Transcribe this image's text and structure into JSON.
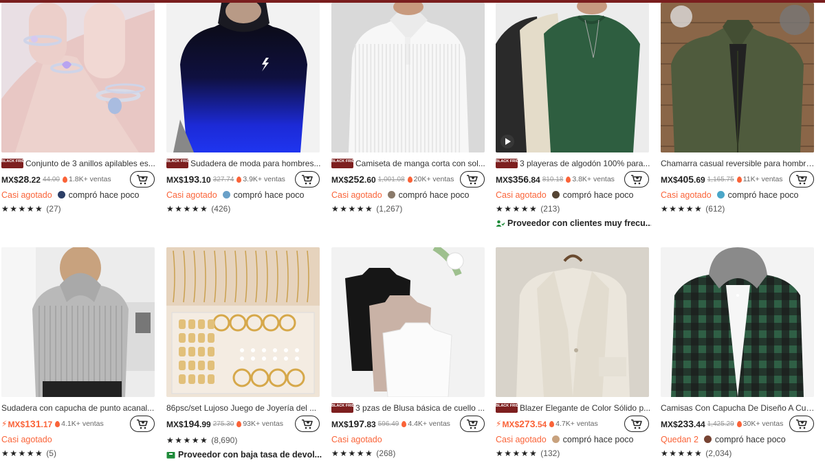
{
  "colors": {
    "accent": "#fa6338",
    "black_friday": "#7d1f1f",
    "supplier_badge": "#1f8b3a"
  },
  "products": [
    {
      "title": "Conjunto de 3 anillos apilables es...",
      "black_friday": true,
      "black_friday_label": "BLACK FRIDAY",
      "currency": "MX$",
      "price_int": "28",
      "price_dec": ".22",
      "old_price": "44.00",
      "sales": "1.8K+ ventas",
      "flash": false,
      "stock": "Casi agotado",
      "buyer": "compró hace poco",
      "stars": "★★★★★",
      "reviews": "(27)",
      "badge": "",
      "image_icon": "rings-photo",
      "video": false
    },
    {
      "title": "Sudadera de moda para hombres...",
      "black_friday": true,
      "black_friday_label": "BLACK FRIDAY",
      "currency": "MX$",
      "price_int": "193",
      "price_dec": ".10",
      "old_price": "327.74",
      "sales": "3.9K+ ventas",
      "flash": false,
      "stock": "Casi agotado",
      "buyer": "compró hace poco",
      "stars": "★★★★★",
      "reviews": "(426)",
      "badge": "",
      "image_icon": "hoodie-photo",
      "video": false
    },
    {
      "title": "Camiseta de manga corta con sol...",
      "black_friday": true,
      "black_friday_label": "BLACK FRIDAY",
      "currency": "MX$",
      "price_int": "252",
      "price_dec": ".60",
      "old_price": "1,001.08",
      "sales": "20K+ ventas",
      "flash": false,
      "stock": "Casi agotado",
      "buyer": "compró hace poco",
      "stars": "★★★★★",
      "reviews": "(1,267)",
      "badge": "",
      "image_icon": "white-polo-photo",
      "video": false
    },
    {
      "title": "3 playeras de algodón 100% para...",
      "black_friday": true,
      "black_friday_label": "BLACK FRIDAY",
      "currency": "MX$",
      "price_int": "356",
      "price_dec": ".84",
      "old_price": "810.18",
      "sales": "3.8K+ ventas",
      "flash": false,
      "stock": "Casi agotado",
      "buyer": "compró hace poco",
      "stars": "★★★★★",
      "reviews": "(213)",
      "badge": "Proveedor con clientes muy frecu...",
      "badge_type": "people",
      "image_icon": "tshirts-photo",
      "video": true
    },
    {
      "title": "Chamarra casual reversible para hombre...",
      "black_friday": false,
      "black_friday_label": "",
      "currency": "MX$",
      "price_int": "405",
      "price_dec": ".69",
      "old_price": "1,165.75",
      "sales": "11K+ ventas",
      "flash": false,
      "stock": "Casi agotado",
      "buyer": "compró hace poco",
      "stars": "★★★★★",
      "reviews": "(612)",
      "badge": "",
      "image_icon": "jacket-photo",
      "video": false
    },
    {
      "title": "Sudadera con capucha de punto acanal...",
      "black_friday": false,
      "black_friday_label": "",
      "currency": "MX$",
      "price_int": "131",
      "price_dec": ".17",
      "old_price": "",
      "sales": "4.1K+ ventas",
      "flash": true,
      "stock": "Casi agotado",
      "buyer": "",
      "stars": "★★★★★",
      "reviews": "(5)",
      "badge": "",
      "image_icon": "knit-hoodie-photo",
      "video": false
    },
    {
      "title": "86psc/set Lujoso Juego de Joyería del ...",
      "black_friday": false,
      "black_friday_label": "",
      "currency": "MX$",
      "price_int": "194",
      "price_dec": ".99",
      "old_price": "275.30",
      "sales": "93K+ ventas",
      "flash": false,
      "stock": "",
      "buyer": "",
      "stars": "★★★★★",
      "reviews": "(8,690)",
      "badge": "Proveedor con baja tasa de devol...",
      "badge_type": "box",
      "image_icon": "jewelry-set-photo",
      "video": false
    },
    {
      "title": "3 pzas de Blusa básica de cuello ...",
      "black_friday": true,
      "black_friday_label": "BLACK FRIDAY",
      "currency": "MX$",
      "price_int": "197",
      "price_dec": ".83",
      "old_price": "596.49",
      "sales": "4.4K+ ventas",
      "flash": false,
      "stock": "Casi agotado",
      "buyer": "",
      "stars": "★★★★★",
      "reviews": "(268)",
      "badge": "",
      "image_icon": "tank-tops-photo",
      "video": false
    },
    {
      "title": "Blazer Elegante de Color Sólido p...",
      "black_friday": true,
      "black_friday_label": "BLACK FRIDAY",
      "currency": "MX$",
      "price_int": "273",
      "price_dec": ".54",
      "old_price": "",
      "sales": "4.7K+ ventas",
      "flash": true,
      "stock": "Casi agotado",
      "buyer": "compró hace poco",
      "stars": "★★★★★",
      "reviews": "(132)",
      "badge": "",
      "image_icon": "blazer-photo",
      "video": false
    },
    {
      "title": "Camisas Con Capucha De Diseño A Cua...",
      "black_friday": false,
      "black_friday_label": "",
      "currency": "MX$",
      "price_int": "233",
      "price_dec": ".44",
      "old_price": "1,425.29",
      "sales": "30K+ ventas",
      "flash": false,
      "stock": "Quedan 2",
      "buyer": "compró hace poco",
      "stars": "★★★★★",
      "reviews": "(2,034)",
      "badge": "",
      "image_icon": "plaid-shirt-photo",
      "video": false
    }
  ]
}
